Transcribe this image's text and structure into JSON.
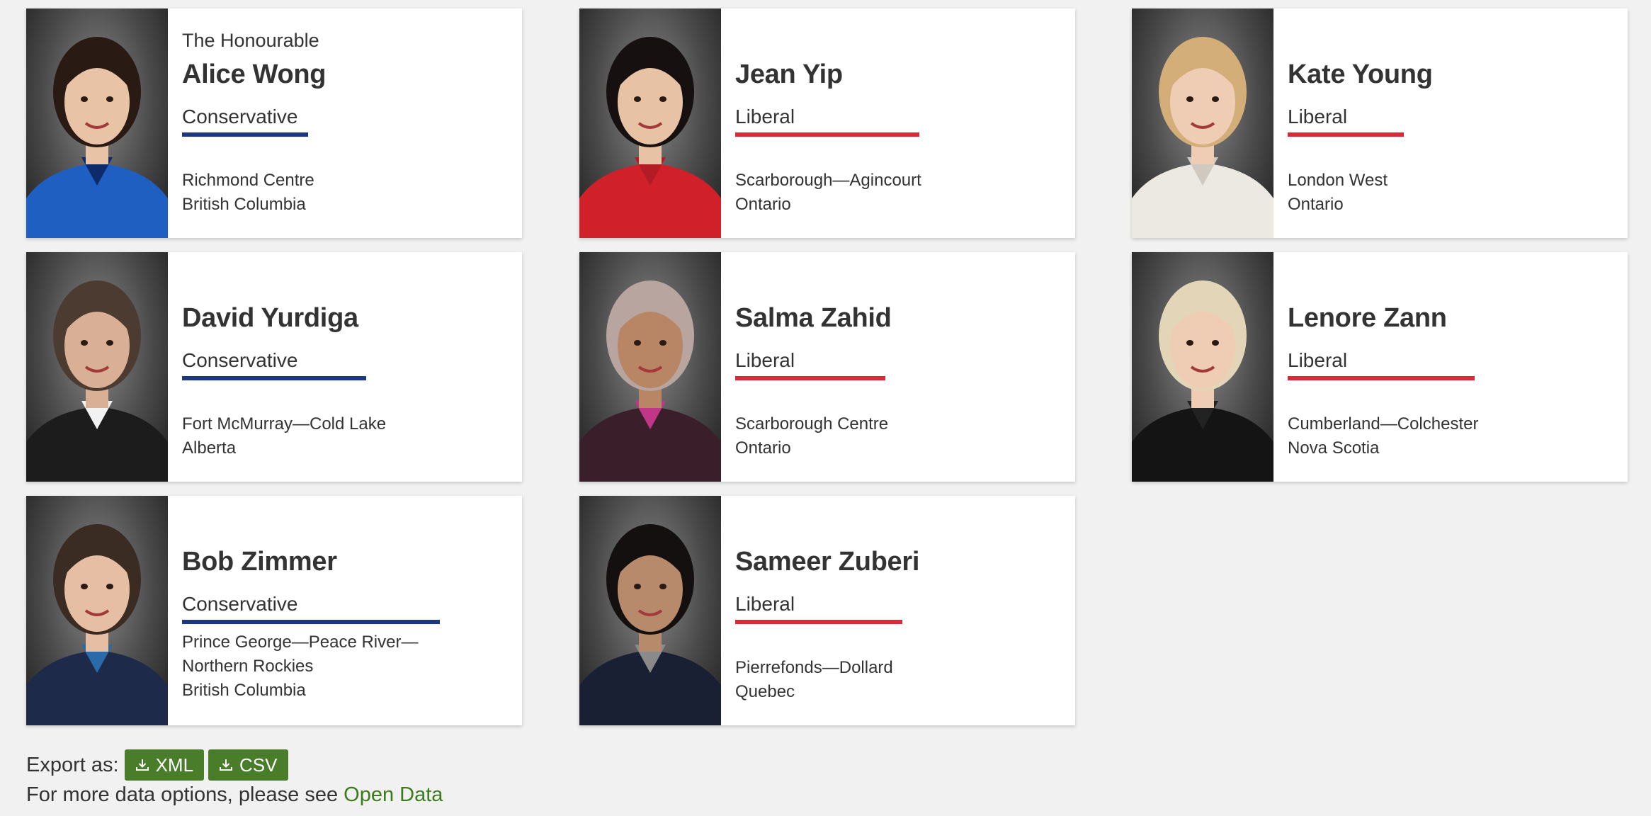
{
  "members": [
    {
      "honorific": "The Honourable",
      "name": "Alice Wong",
      "party": "Conservative",
      "riding_lines": [
        "Richmond Centre",
        "British Columbia"
      ],
      "portrait": {
        "suit": "#1f5fc2",
        "hair": "#2a1a14",
        "skin": "#e9c3a6",
        "accent": "#0d2a6b"
      }
    },
    {
      "honorific": "",
      "name": "Jean Yip",
      "party": "Liberal",
      "riding_lines": [
        "Scarborough—Agincourt",
        "Ontario"
      ],
      "portrait": {
        "suit": "#d0202a",
        "hair": "#161010",
        "skin": "#e8c2a4",
        "accent": "#b41c25"
      }
    },
    {
      "honorific": "",
      "name": "Kate Young",
      "party": "Liberal",
      "riding_lines": [
        "London West",
        "Ontario"
      ],
      "portrait": {
        "suit": "#ece8e2",
        "hair": "#d3ae78",
        "skin": "#efcdb4",
        "accent": "#cfc9c0"
      }
    },
    {
      "honorific": "",
      "name": "David Yurdiga",
      "party": "Conservative",
      "riding_lines": [
        "Fort McMurray—Cold Lake",
        "Alberta"
      ],
      "portrait": {
        "suit": "#1c1c1c",
        "hair": "#4b3b30",
        "skin": "#d9b095",
        "accent": "#f2f2f2"
      }
    },
    {
      "honorific": "",
      "name": "Salma Zahid",
      "party": "Liberal",
      "riding_lines": [
        "Scarborough Centre",
        "Ontario"
      ],
      "portrait": {
        "suit": "#3a1f2a",
        "hair": "#b9a5a0",
        "skin": "#b88565",
        "accent": "#c2368a"
      }
    },
    {
      "honorific": "",
      "name": "Lenore Zann",
      "party": "Liberal",
      "riding_lines": [
        "Cumberland—Colchester",
        "Nova Scotia"
      ],
      "portrait": {
        "suit": "#141414",
        "hair": "#e3d6b8",
        "skin": "#efcdb4",
        "accent": "#222222"
      }
    },
    {
      "honorific": "",
      "name": "Bob Zimmer",
      "party": "Conservative",
      "riding_lines": [
        "Prince George—Peace River—",
        "Northern Rockies",
        "British Columbia"
      ],
      "portrait": {
        "suit": "#1d2a4a",
        "hair": "#3a2c22",
        "skin": "#e6bea3",
        "accent": "#2b6aa8"
      }
    },
    {
      "honorific": "",
      "name": "Sameer Zuberi",
      "party": "Liberal",
      "riding_lines": [
        "Pierrefonds—Dollard",
        "Quebec"
      ],
      "portrait": {
        "suit": "#1a2033",
        "hair": "#141010",
        "skin": "#b78a6b",
        "accent": "#8a8a8a"
      }
    }
  ],
  "party_colors": {
    "Liberal": "#d92b35",
    "Conservative": "#1b3687"
  },
  "export": {
    "label": "Export as:",
    "xml_label": "XML",
    "csv_label": "CSV",
    "button_color": "#4a7d2a"
  },
  "more": {
    "prefix": "For more data options, please see ",
    "link_label": "Open Data",
    "link_color": "#3d7a1d"
  }
}
